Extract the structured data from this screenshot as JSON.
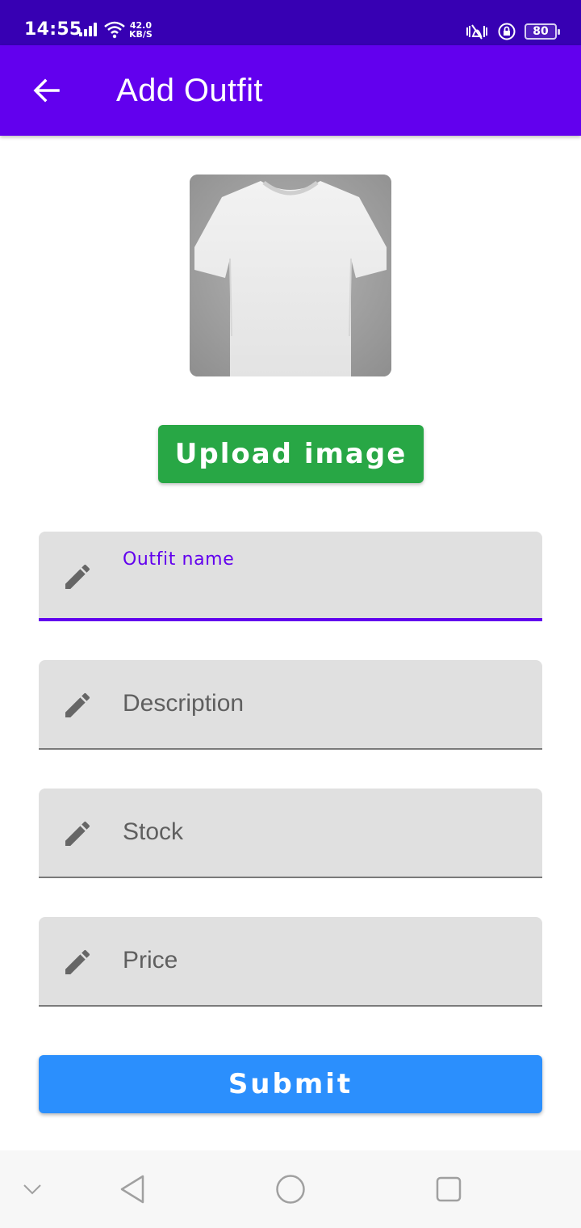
{
  "status_bar": {
    "time": "14:55",
    "net_speed_value": "42.0",
    "net_speed_unit": "KB/S",
    "battery": "80",
    "icons": [
      "signal-icon",
      "wifi-icon",
      "vibrate-icon",
      "rotation-lock-icon",
      "battery-icon"
    ]
  },
  "app_bar": {
    "title": "Add Outfit",
    "back_icon": "arrow-back-icon",
    "color": "#6200ee"
  },
  "product": {
    "image_alt": "white-tshirt-image",
    "upload_label": "Upload image",
    "upload_color": "#28a745"
  },
  "form": {
    "fields": [
      {
        "id": "name",
        "label": "Outfit name",
        "value": "",
        "focused": true,
        "icon": "pencil-icon"
      },
      {
        "id": "description",
        "label": "Description",
        "value": "",
        "focused": false,
        "icon": "pencil-icon"
      },
      {
        "id": "stock",
        "label": "Stock",
        "value": "",
        "focused": false,
        "icon": "pencil-icon"
      },
      {
        "id": "price",
        "label": "Price",
        "value": "",
        "focused": false,
        "icon": "pencil-icon"
      }
    ],
    "submit_label": "Submit",
    "submit_color": "#2b8ffd",
    "accent": "#6200ee"
  },
  "nav_bar": {
    "icons": [
      "chevron-down-icon",
      "back-triangle-icon",
      "home-circle-icon",
      "recents-square-icon"
    ]
  }
}
